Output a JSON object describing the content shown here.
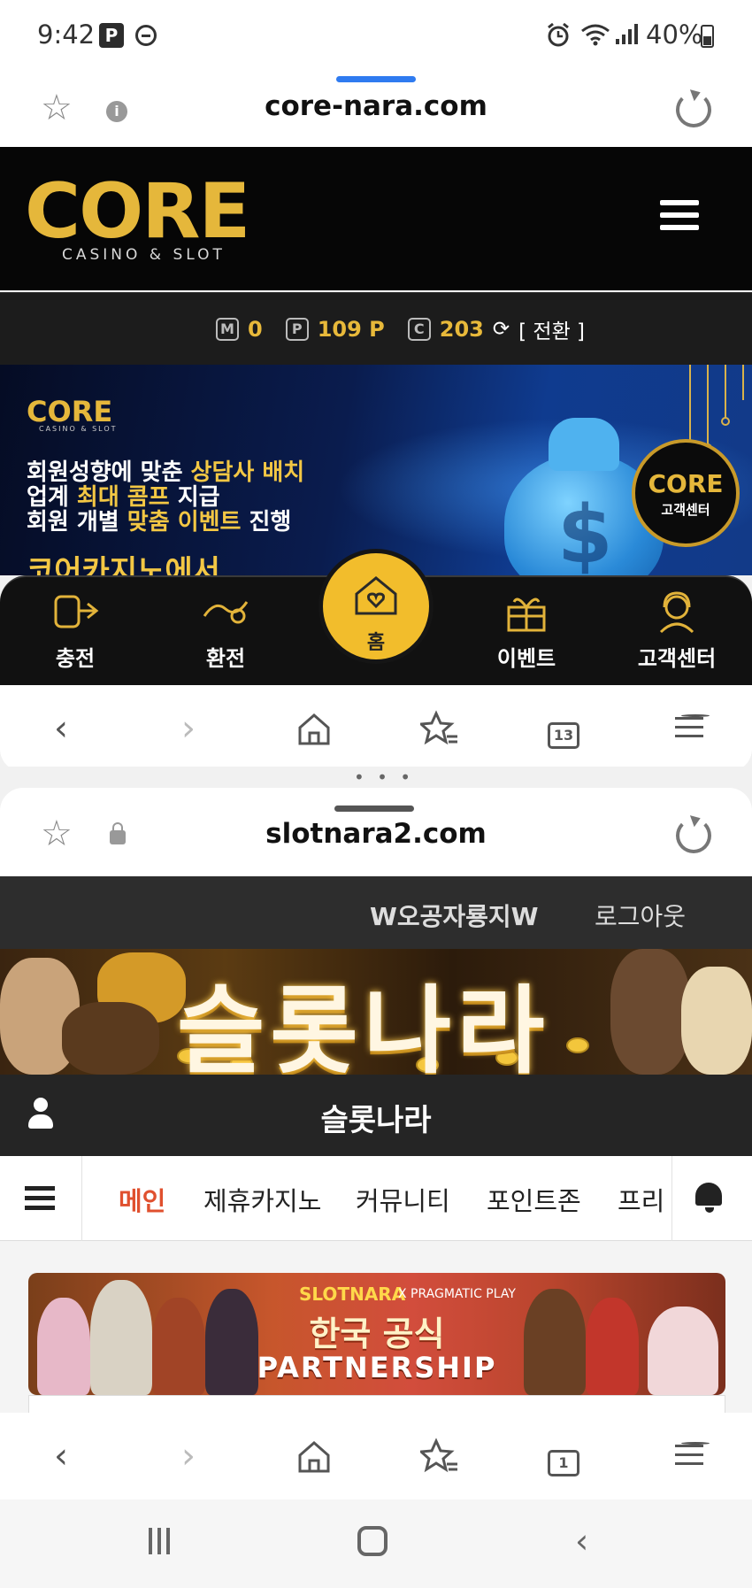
{
  "status_bar": {
    "time": "9:42",
    "badge": "P",
    "battery": "40%"
  },
  "top_browser": {
    "url": "core-nara.com",
    "tab_count": "13",
    "accent": "#2f7bf0"
  },
  "core_site": {
    "logo_text": "CORE",
    "logo_subtitle": "CASINO & SLOT",
    "points": {
      "m_label": "M",
      "m_value": "0",
      "p_label": "P",
      "p_value": "109 P",
      "c_label": "C",
      "c_value": "203",
      "switch_label": "[ 전환 ]"
    },
    "banner": {
      "mini_logo": "CORE",
      "mini_logo_sub": "CASINO & SLOT",
      "line1_a": "회원성향에 맞춘 ",
      "line1_b": "상담사 배치",
      "line2_a": "업계 ",
      "line2_b": "최대 콤프",
      "line2_c": " 지급",
      "line3_a": "회원 개별 ",
      "line3_b": "맞춤 이벤트",
      "line3_c": " 진행",
      "line4": "코어카지노에서",
      "badge_logo": "CORE",
      "badge_label": "고객센터"
    },
    "quick_nav": [
      {
        "label": "충전",
        "icon": "deposit-icon"
      },
      {
        "label": "환전",
        "icon": "exchange-icon"
      },
      {
        "label": "홈",
        "icon": "home-heart-icon"
      },
      {
        "label": "이벤트",
        "icon": "gift-icon"
      },
      {
        "label": "고객센터",
        "icon": "support-icon"
      }
    ],
    "accent": "#e5b73b"
  },
  "bottom_browser": {
    "url": "slotnara2.com",
    "tab_count": "1"
  },
  "slotnara_site": {
    "username": "W오공자룡지W",
    "logout": "로그아웃",
    "banner_title": "슬롯나라",
    "page_title": "슬롯나라",
    "menu": [
      "메인",
      "제휴카지노",
      "커뮤니티",
      "포인트존",
      "프리"
    ],
    "promo": {
      "brand": "SLOTNARA",
      "x_partner": "X PRAGMATIC PLAY",
      "line1": "한국 공식",
      "line2": "PARTNERSHIP"
    },
    "active_color": "#e0502e"
  }
}
